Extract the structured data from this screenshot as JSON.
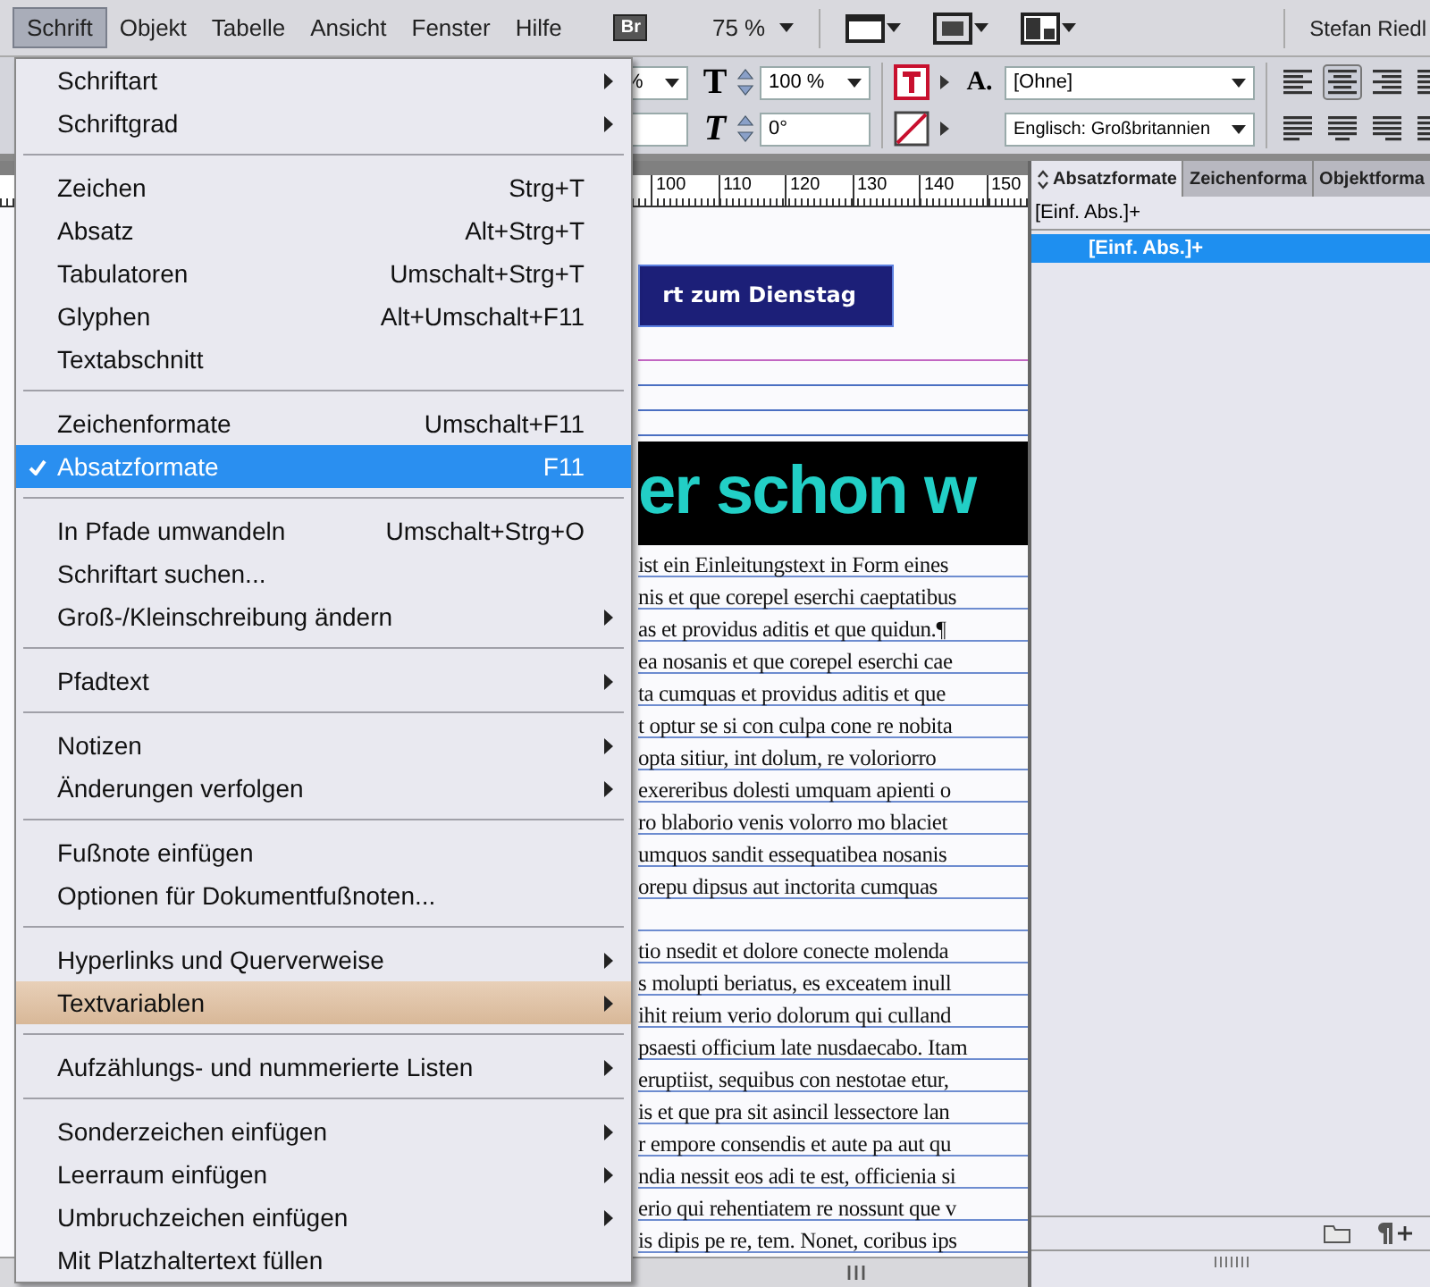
{
  "menu_bar": {
    "items": [
      {
        "label": "Schrift",
        "selected": true
      },
      {
        "label": "Objekt",
        "selected": false
      },
      {
        "label": "Tabelle",
        "selected": false
      },
      {
        "label": "Ansicht",
        "selected": false
      },
      {
        "label": "Fenster",
        "selected": false
      },
      {
        "label": "Hilfe",
        "selected": false
      }
    ],
    "bridge_button": "Br",
    "zoom": "75 %",
    "user": "Stefan Riedl"
  },
  "toolbar": {
    "font_size_field": "%",
    "scale_symbol": "T",
    "horizontal_scale": "100 %",
    "skew_symbol": "T",
    "rotation": "0°",
    "char_style_symbol": "A.",
    "paragraph_style": "[Ohne]",
    "language": "Englisch: Großbritannien"
  },
  "document": {
    "ruler": [
      "100",
      "110",
      "120",
      "130",
      "140",
      "150"
    ],
    "banner_text": "rt zum Dienstag",
    "headline": "er schon w",
    "paragraphs": [
      [
        "ist ein Einleitungstext in Form eines",
        "nis et que corepel eserchi caeptatibus",
        "as et providus aditis et que quidun.¶",
        "ea nosanis et que corepel eserchi cae",
        "ta cumquas et providus aditis et que",
        "t optur se si con culpa cone re nobita",
        "opta sitiur, int dolum, re voloriorro",
        "exereribus dolesti umquam apienti o",
        "ro blaborio venis volorro mo blaciet",
        "umquos sandit essequatibea nosanis",
        "orepu dipsus aut inctorita cumquas"
      ],
      [
        "tio nsedit et dolore conecte molenda",
        "s molupti beriatus, es exceatem inull",
        "ihit reium verio dolorum qui culland",
        "psaesti officium late nusdaecabo. Itam",
        "eruptiist, sequibus con nestotae etur,",
        "is et que pra sit asincil lessectore lan",
        "r empore consendis et aute pa aut qu",
        "ndia nessit eos adi te est, officienia si",
        "erio qui rehentiatem re nossunt que v",
        "is dipis pe re, tem. Nonet, coribus ips"
      ]
    ]
  },
  "panel": {
    "tabs": [
      {
        "label": "Absatzformate",
        "selected": true
      },
      {
        "label": "Zeichenforma",
        "selected": false
      },
      {
        "label": "Objektforma",
        "selected": false
      }
    ],
    "current_style": "[Einf. Abs.]+",
    "styles": [
      {
        "label": "[Einf. Abs.]+",
        "selected": true
      }
    ]
  },
  "dropdown_menu": {
    "entries": [
      {
        "kind": "item",
        "label": "Schriftart",
        "submenu": true,
        "checked": false,
        "selected": false,
        "hovered": false
      },
      {
        "kind": "item",
        "label": "Schriftgrad",
        "submenu": true,
        "checked": false,
        "selected": false,
        "hovered": false
      },
      {
        "kind": "separator"
      },
      {
        "kind": "item",
        "label": "Zeichen",
        "shortcut": "Strg+T",
        "submenu": false,
        "checked": false,
        "selected": false,
        "hovered": false
      },
      {
        "kind": "item",
        "label": "Absatz",
        "shortcut": "Alt+Strg+T",
        "submenu": false,
        "checked": false,
        "selected": false,
        "hovered": false
      },
      {
        "kind": "item",
        "label": "Tabulatoren",
        "shortcut": "Umschalt+Strg+T",
        "submenu": false,
        "checked": false,
        "selected": false,
        "hovered": false
      },
      {
        "kind": "item",
        "label": "Glyphen",
        "shortcut": "Alt+Umschalt+F11",
        "submenu": false,
        "checked": false,
        "selected": false,
        "hovered": false
      },
      {
        "kind": "item",
        "label": "Textabschnitt",
        "submenu": false,
        "checked": false,
        "selected": false,
        "hovered": false
      },
      {
        "kind": "separator"
      },
      {
        "kind": "item",
        "label": "Zeichenformate",
        "shortcut": "Umschalt+F11",
        "submenu": false,
        "checked": false,
        "selected": false,
        "hovered": false
      },
      {
        "kind": "item",
        "label": "Absatzformate",
        "shortcut": "F11",
        "submenu": false,
        "checked": true,
        "selected": true,
        "hovered": false
      },
      {
        "kind": "separator"
      },
      {
        "kind": "item",
        "label": "In Pfade umwandeln",
        "shortcut": "Umschalt+Strg+O",
        "submenu": false,
        "checked": false,
        "selected": false,
        "hovered": false
      },
      {
        "kind": "item",
        "label": "Schriftart suchen...",
        "submenu": false,
        "checked": false,
        "selected": false,
        "hovered": false
      },
      {
        "kind": "item",
        "label": "Groß-/Kleinschreibung ändern",
        "submenu": true,
        "checked": false,
        "selected": false,
        "hovered": false
      },
      {
        "kind": "separator"
      },
      {
        "kind": "item",
        "label": "Pfadtext",
        "submenu": true,
        "checked": false,
        "selected": false,
        "hovered": false
      },
      {
        "kind": "separator"
      },
      {
        "kind": "item",
        "label": "Notizen",
        "submenu": true,
        "checked": false,
        "selected": false,
        "hovered": false
      },
      {
        "kind": "item",
        "label": "Änderungen verfolgen",
        "submenu": true,
        "checked": false,
        "selected": false,
        "hovered": false
      },
      {
        "kind": "separator"
      },
      {
        "kind": "item",
        "label": "Fußnote einfügen",
        "submenu": false,
        "checked": false,
        "selected": false,
        "hovered": false
      },
      {
        "kind": "item",
        "label": "Optionen für Dokumentfußnoten...",
        "submenu": false,
        "checked": false,
        "selected": false,
        "hovered": false
      },
      {
        "kind": "separator"
      },
      {
        "kind": "item",
        "label": "Hyperlinks und Querverweise",
        "submenu": true,
        "checked": false,
        "selected": false,
        "hovered": false
      },
      {
        "kind": "item",
        "label": "Textvariablen",
        "submenu": true,
        "checked": false,
        "selected": false,
        "hovered": true
      },
      {
        "kind": "separator"
      },
      {
        "kind": "item",
        "label": "Aufzählungs- und nummerierte Listen",
        "submenu": true,
        "checked": false,
        "selected": false,
        "hovered": false
      },
      {
        "kind": "separator"
      },
      {
        "kind": "item",
        "label": "Sonderzeichen einfügen",
        "submenu": true,
        "checked": false,
        "selected": false,
        "hovered": false
      },
      {
        "kind": "item",
        "label": "Leerraum einfügen",
        "submenu": true,
        "checked": false,
        "selected": false,
        "hovered": false
      },
      {
        "kind": "item",
        "label": "Umbruchzeichen einfügen",
        "submenu": true,
        "checked": false,
        "selected": false,
        "hovered": false
      },
      {
        "kind": "item",
        "label": "Mit Platzhaltertext füllen",
        "submenu": false,
        "checked": false,
        "selected": false,
        "hovered": false
      }
    ]
  }
}
